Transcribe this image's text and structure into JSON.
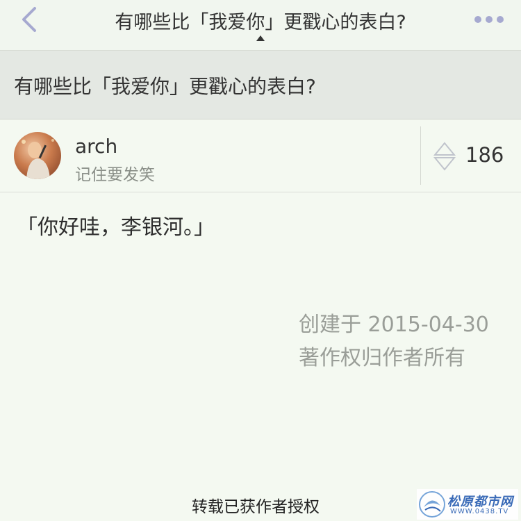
{
  "navbar": {
    "title": "有哪些比「我爱你」更戳心的表白?",
    "back_icon": "chevron-left-icon",
    "more_icon": "more-dots-icon",
    "accent": "#a6a9d0"
  },
  "question": {
    "title": "有哪些比「我爱你」更戳心的表白?"
  },
  "author": {
    "name": "arch",
    "bio": "记住要发笑",
    "avatar_icon": "avatar"
  },
  "vote": {
    "count": "186",
    "icon": "vote-arrows-icon"
  },
  "answer": {
    "text": "「你好哇，李银河。」"
  },
  "meta": {
    "created": "创建于 2015-04-30",
    "copyright": "著作权归作者所有"
  },
  "footer": {
    "note": "转载已获作者授权"
  },
  "watermark": {
    "name": "松原都市网",
    "url": "WWW.0438.TV"
  }
}
